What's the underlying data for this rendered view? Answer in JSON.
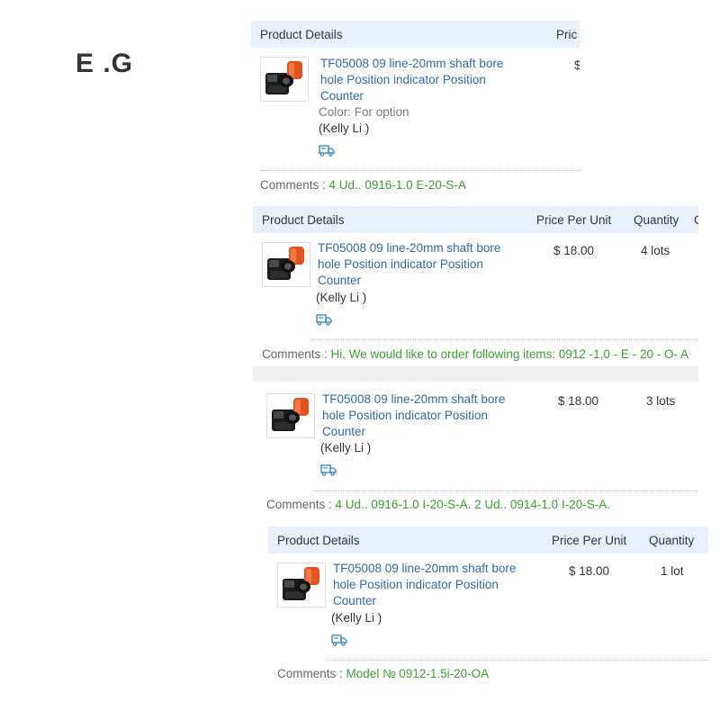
{
  "eg_label": "E .G",
  "header": {
    "product": "Product Details",
    "price_short": "Pric",
    "price": "Price Per Unit",
    "quantity": "Quantity",
    "extra": "C"
  },
  "product": {
    "title_l1": "TF05008 09 line-20mm shaft bore",
    "title_l2": "hole Position indicator Position",
    "title_l3": "Counter",
    "color": "Color: For option",
    "seller": "(Kelly Li )",
    "price": "$ 18.00",
    "price_cut": "$"
  },
  "comments_label": "Comments :",
  "orders": [
    {
      "quantity": "",
      "comment": "4 Ud.. 0916-1.0 E-20-S-A"
    },
    {
      "quantity": "4 lots",
      "comment": "Hi, We would like to order following items: 0912 -1,0 - E - 20 - O- A"
    },
    {
      "quantity": "3 lots",
      "comment": "4 Ud.. 0916-1.0 I-20-S-A. 2 Ud.. 0914-1.0 I-20-S-A."
    },
    {
      "quantity": "1 lot",
      "comment": "Model № 0912-1.5i-20-OA"
    }
  ],
  "icons": {
    "thumbnail": "product-thumbnail-icon",
    "shipping": "shipping-truck-icon"
  }
}
